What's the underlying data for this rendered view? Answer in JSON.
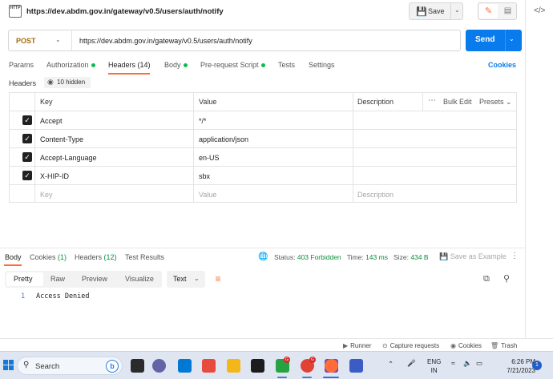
{
  "request": {
    "title": "https://dev.abdm.gov.in/gateway/v0.5/users/auth/notify",
    "icon_text": "HTTP",
    "method": "POST",
    "url": "https://dev.abdm.gov.in/gateway/v0.5/users/auth/notify"
  },
  "toolbar": {
    "save_label": "Save",
    "send_label": "Send"
  },
  "tabs": [
    {
      "label": "Params"
    },
    {
      "label": "Authorization"
    },
    {
      "label": "Headers (14)"
    },
    {
      "label": "Body"
    },
    {
      "label": "Pre-request Script"
    },
    {
      "label": "Tests"
    },
    {
      "label": "Settings"
    }
  ],
  "cookies_label": "Cookies",
  "headers_section": {
    "label": "Headers",
    "hidden_label": "10 hidden"
  },
  "table": {
    "columns": {
      "key": "Key",
      "value": "Value",
      "description": "Description"
    },
    "bulk_edit": "Bulk Edit",
    "presets": "Presets",
    "rows": [
      {
        "key": "Accept",
        "value": "*/*",
        "checked": true
      },
      {
        "key": "Content-Type",
        "value": "application/json",
        "checked": true
      },
      {
        "key": "Accept-Language",
        "value": "en-US",
        "checked": true
      },
      {
        "key": "X-HIP-ID",
        "value": "sbx",
        "checked": true
      }
    ],
    "placeholder": {
      "key": "Key",
      "value": "Value",
      "description": "Description"
    }
  },
  "response": {
    "tabs": [
      {
        "label": "Body"
      },
      {
        "label": "Cookies",
        "count": "(1)"
      },
      {
        "label": "Headers",
        "count": "(12)"
      },
      {
        "label": "Test Results"
      }
    ],
    "status_label": "Status:",
    "status_value": "403 Forbidden",
    "time_label": "Time:",
    "time_value": "143 ms",
    "size_label": "Size:",
    "size_value": "434 B",
    "save_example": "Save as Example",
    "views": [
      "Pretty",
      "Raw",
      "Preview",
      "Visualize"
    ],
    "format": "Text",
    "line_number": "1",
    "body_line": "Access Denied"
  },
  "statusbar": {
    "runner": "Runner",
    "capture": "Capture requests",
    "cookies": "Cookies",
    "trash": "Trash"
  },
  "taskbar": {
    "search_label": "Search",
    "lang_line1": "ENG",
    "lang_line2": "IN",
    "time": "6:26 PM",
    "date": "7/21/2023",
    "notifications": "1"
  },
  "colors": {
    "accent": "#ff6c37",
    "send": "#097bed",
    "method": "#a66a0c",
    "status_ok_dot": "#0cbb52"
  }
}
